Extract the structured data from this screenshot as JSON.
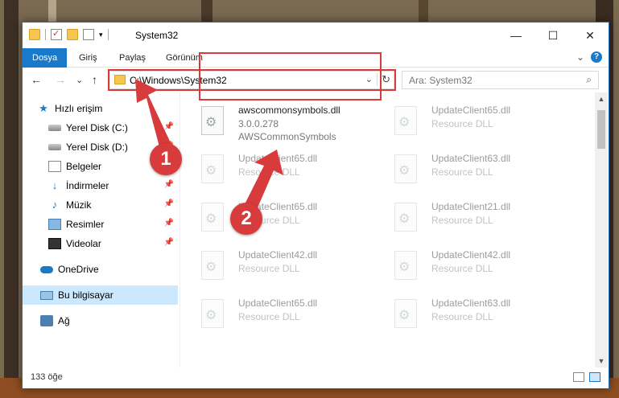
{
  "window": {
    "title": "System32",
    "min_glyph": "—",
    "max_glyph": "☐",
    "close_glyph": "✕"
  },
  "ribbon": {
    "tabs": [
      "Dosya",
      "Giriş",
      "Paylaş",
      "Görünüm"
    ],
    "help_glyph": "?",
    "expand_glyph": "⌄"
  },
  "nav": {
    "back_glyph": "←",
    "forward_glyph": "→",
    "recent_glyph": "⌄",
    "up_glyph": "↑",
    "address": "C:\\Windows\\System32",
    "address_chevron": "⌄",
    "refresh_glyph": "↻",
    "search_placeholder": "Ara: System32",
    "search_glyph": "⌕"
  },
  "sidebar": {
    "items": [
      {
        "label": "Hızlı erişim",
        "icon": "star-icon",
        "pinned": false
      },
      {
        "label": "Yerel Disk (C:)",
        "icon": "disk-icon",
        "pinned": true
      },
      {
        "label": "Yerel Disk (D:)",
        "icon": "disk-icon",
        "pinned": true
      },
      {
        "label": "Belgeler",
        "icon": "documents-icon",
        "pinned": true
      },
      {
        "label": "İndirmeler",
        "icon": "download-icon",
        "pinned": true
      },
      {
        "label": "Müzik",
        "icon": "music-icon",
        "pinned": true
      },
      {
        "label": "Resimler",
        "icon": "pictures-icon",
        "pinned": true
      },
      {
        "label": "Videolar",
        "icon": "videos-icon",
        "pinned": true
      },
      {
        "label": "OneDrive",
        "icon": "cloud-icon",
        "pinned": false
      },
      {
        "label": "Bu bilgisayar",
        "icon": "computer-icon",
        "pinned": false
      },
      {
        "label": "Ağ",
        "icon": "network-icon",
        "pinned": false
      }
    ],
    "pin_glyph": "📌"
  },
  "files": [
    {
      "name": "awscommonsymbols.dll",
      "line1": "3.0.0.278",
      "line2": "AWSCommonSymbols"
    },
    {
      "name": "UpdateClient65.dll",
      "line1": "Resource DLL",
      "line2": ""
    },
    {
      "name": "UpdateClient65.dll",
      "line1": "Resource DLL",
      "line2": ""
    },
    {
      "name": "UpdateClient63.dll",
      "line1": "Resource DLL",
      "line2": ""
    },
    {
      "name": "UpdateClient65.dll",
      "line1": "Resource DLL",
      "line2": ""
    },
    {
      "name": "UpdateClient21.dll",
      "line1": "Resource DLL",
      "line2": ""
    },
    {
      "name": "UpdateClient42.dll",
      "line1": "Resource DLL",
      "line2": ""
    },
    {
      "name": "UpdateClient42.dll",
      "line1": "Resource DLL",
      "line2": ""
    },
    {
      "name": "UpdateClient65.dll",
      "line1": "Resource DLL",
      "line2": ""
    },
    {
      "name": "UpdateClient63.dll",
      "line1": "Resource DLL",
      "line2": ""
    }
  ],
  "status": {
    "count": "133 öğe"
  },
  "annotations": {
    "badge1": "1",
    "badge2": "2",
    "accent": "#d83b3b"
  }
}
